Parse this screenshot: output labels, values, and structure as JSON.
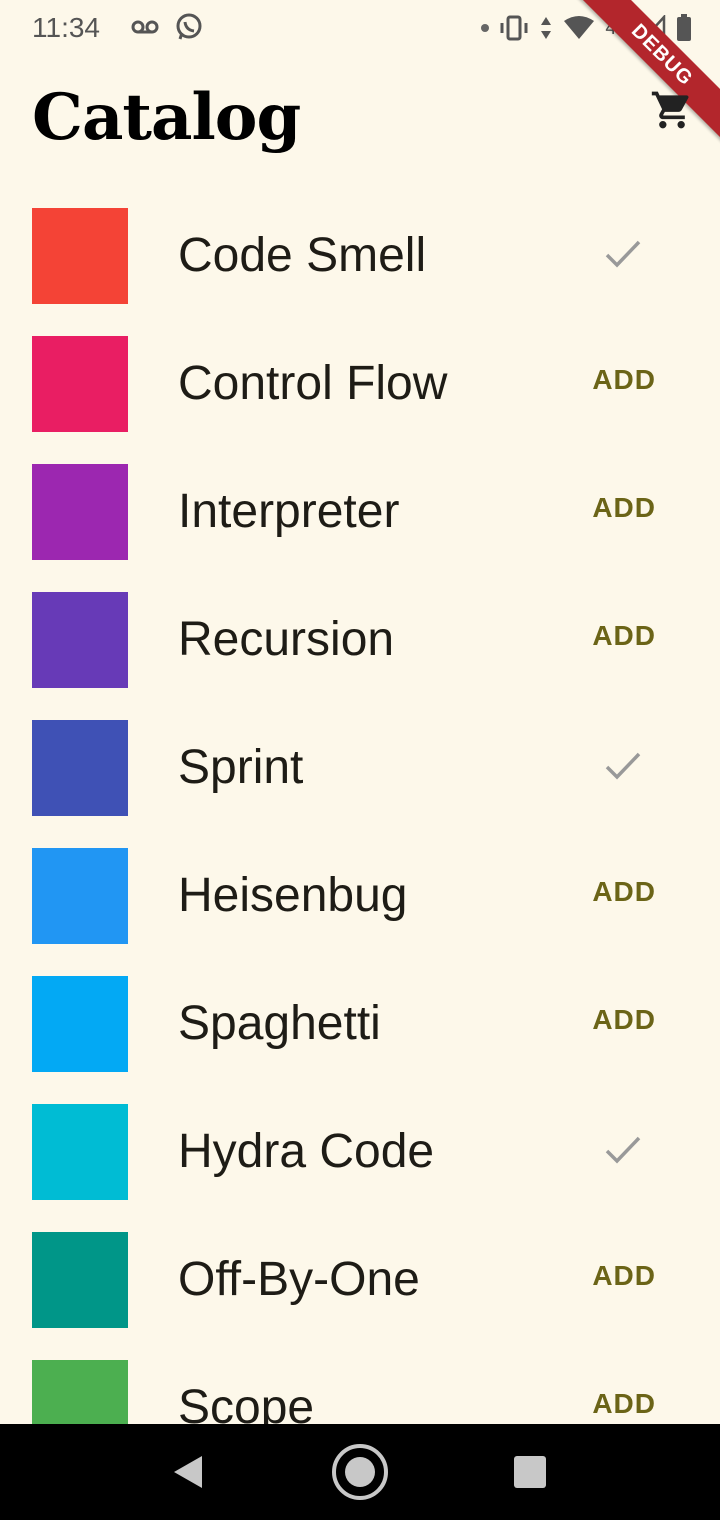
{
  "status_bar": {
    "time": "11:34",
    "left_icons": [
      "voicemail-icon",
      "whatsapp-icon"
    ],
    "right_icons": [
      "notification-dot-icon",
      "vibrate-icon",
      "data-arrows-icon",
      "wifi-icon",
      "signal-icon",
      "battery-icon"
    ],
    "network_label": "4G"
  },
  "debug_banner": "DEBUG",
  "app_bar": {
    "title": "Catalog",
    "cart_icon": "cart-icon"
  },
  "items": [
    {
      "name": "Code Smell",
      "color": "#f44336",
      "in_cart": true,
      "action": ""
    },
    {
      "name": "Control Flow",
      "color": "#e91e63",
      "in_cart": false,
      "action": "ADD"
    },
    {
      "name": "Interpreter",
      "color": "#9c27b0",
      "in_cart": false,
      "action": "ADD"
    },
    {
      "name": "Recursion",
      "color": "#673ab7",
      "in_cart": false,
      "action": "ADD"
    },
    {
      "name": "Sprint",
      "color": "#3f51b5",
      "in_cart": true,
      "action": ""
    },
    {
      "name": "Heisenbug",
      "color": "#2196f3",
      "in_cart": false,
      "action": "ADD"
    },
    {
      "name": "Spaghetti",
      "color": "#03a9f4",
      "in_cart": false,
      "action": "ADD"
    },
    {
      "name": "Hydra Code",
      "color": "#00bcd4",
      "in_cart": true,
      "action": ""
    },
    {
      "name": "Off-By-One",
      "color": "#009688",
      "in_cart": false,
      "action": "ADD"
    },
    {
      "name": "Scope",
      "color": "#4caf50",
      "in_cart": false,
      "action": "ADD"
    }
  ],
  "colors": {
    "background": "#fdf8ea",
    "add_text": "#6b6417",
    "check": "#999999"
  },
  "nav_bar": {
    "icons": [
      "back-icon",
      "home-icon",
      "recents-icon"
    ]
  }
}
